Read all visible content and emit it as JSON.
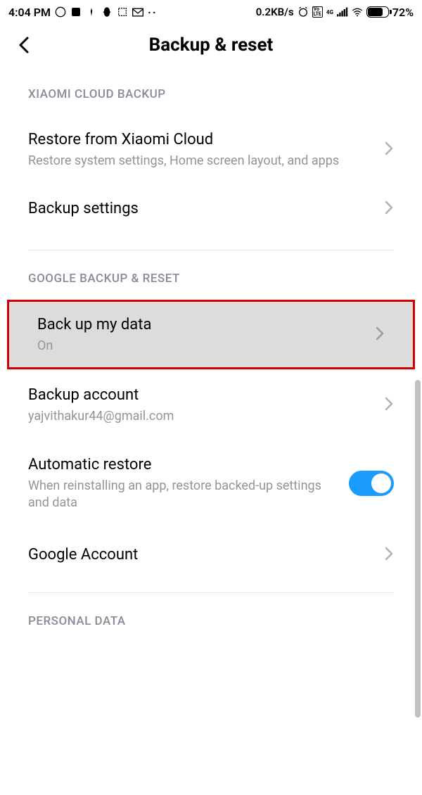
{
  "status": {
    "time": "4:04 PM",
    "data_rate": "0.2KB/s",
    "battery_pct": "72%"
  },
  "header": {
    "title": "Backup & reset"
  },
  "sections": {
    "xiaomi": {
      "label": "XIAOMI CLOUD BACKUP",
      "restore": {
        "title": "Restore from Xiaomi Cloud",
        "subtitle": "Restore system settings, Home screen layout, and apps"
      },
      "backup_settings": {
        "title": "Backup settings"
      }
    },
    "google": {
      "label": "GOOGLE BACKUP & RESET",
      "backup_data": {
        "title": "Back up my data",
        "subtitle": "On"
      },
      "backup_account": {
        "title": "Backup account",
        "subtitle": "yajvithakur44@gmail.com"
      },
      "auto_restore": {
        "title": "Automatic restore",
        "subtitle": "When reinstalling an app, restore backed-up settings and data"
      },
      "google_account": {
        "title": "Google Account"
      }
    },
    "personal": {
      "label": "PERSONAL DATA"
    }
  }
}
